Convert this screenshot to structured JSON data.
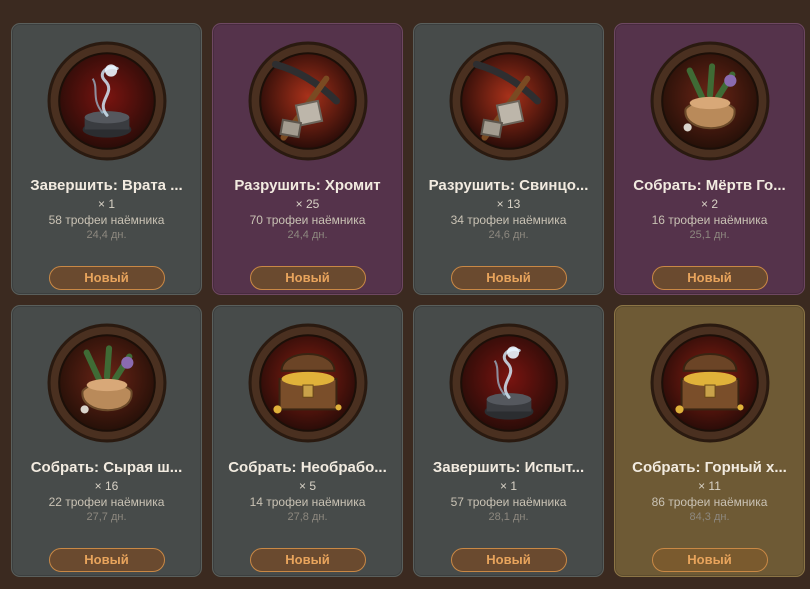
{
  "cards": [
    {
      "title": "Завершить: Врата ...",
      "qty": "× 1",
      "trophies": "58 трофеи наёмника",
      "days": "24,4 дн.",
      "status": "Новый",
      "theme": "gray",
      "icon": "portal-icon"
    },
    {
      "title": "Разрушить: Хромит",
      "qty": "× 25",
      "trophies": "70 трофеи наёмника",
      "days": "24,4 дн.",
      "status": "Новый",
      "theme": "purple",
      "icon": "pickaxe-icon"
    },
    {
      "title": "Разрушить: Свинцо...",
      "qty": "× 13",
      "trophies": "34 трофеи наёмника",
      "days": "24,6 дн.",
      "status": "Новый",
      "theme": "gray",
      "icon": "pickaxe-icon"
    },
    {
      "title": "Собрать: Мёртв Го...",
      "qty": "× 2",
      "trophies": "16 трофеи наёмника",
      "days": "25,1 дн.",
      "status": "Новый",
      "theme": "purple",
      "icon": "herb-sack-icon"
    },
    {
      "title": "Собрать: Сырая ш...",
      "qty": "× 16",
      "trophies": "22 трофеи наёмника",
      "days": "27,7 дн.",
      "status": "Новый",
      "theme": "gray",
      "icon": "herb-sack-icon"
    },
    {
      "title": "Собрать: Необрабо...",
      "qty": "× 5",
      "trophies": "14 трофеи наёмника",
      "days": "27,8 дн.",
      "status": "Новый",
      "theme": "gray",
      "icon": "treasure-chest-icon"
    },
    {
      "title": "Завершить: Испыт...",
      "qty": "× 1",
      "trophies": "57 трофеи наёмника",
      "days": "28,1 дн.",
      "status": "Новый",
      "theme": "gray",
      "icon": "portal-icon"
    },
    {
      "title": "Собрать: Горный х...",
      "qty": "× 11",
      "trophies": "86 трофеи наёмника",
      "days": "84,3 дн.",
      "status": "Новый",
      "theme": "gold",
      "icon": "treasure-chest-icon"
    }
  ],
  "colors": {
    "accent": "#e8a45c",
    "gray": "#474b4a",
    "purple": "#55334b",
    "gold": "#6e5a35"
  }
}
